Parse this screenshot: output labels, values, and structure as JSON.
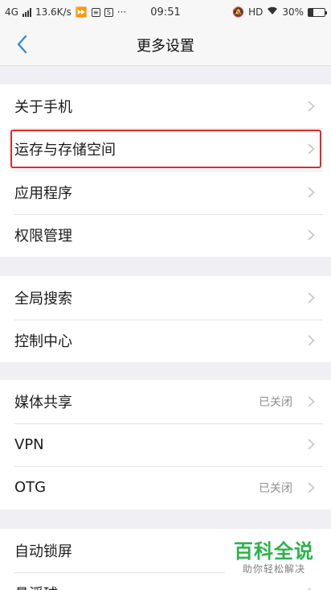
{
  "status_bar": {
    "network": "4G",
    "speed": "13.6K/s",
    "time": "09:51",
    "hd": "HD",
    "battery": "30%",
    "battery_level": 0.3
  },
  "nav": {
    "title": "更多设置"
  },
  "groups": [
    {
      "items": [
        {
          "label": "关于手机",
          "value": ""
        },
        {
          "label": "运存与存储空间",
          "value": ""
        },
        {
          "label": "应用程序",
          "value": ""
        },
        {
          "label": "权限管理",
          "value": ""
        }
      ]
    },
    {
      "items": [
        {
          "label": "全局搜索",
          "value": ""
        },
        {
          "label": "控制中心",
          "value": ""
        }
      ]
    },
    {
      "items": [
        {
          "label": "媒体共享",
          "value": "已关闭"
        },
        {
          "label": "VPN",
          "value": ""
        },
        {
          "label": "OTG",
          "value": "已关闭"
        }
      ]
    },
    {
      "items": [
        {
          "label": "自动锁屏",
          "value": ""
        },
        {
          "label": "悬浮球",
          "value": ""
        }
      ]
    }
  ],
  "watermark": {
    "title": "百科全说",
    "subtitle": "助你轻松解决"
  },
  "colors": {
    "highlight": "#e4262a",
    "accent": "#2b88d8",
    "watermark": "#2bb34a"
  }
}
